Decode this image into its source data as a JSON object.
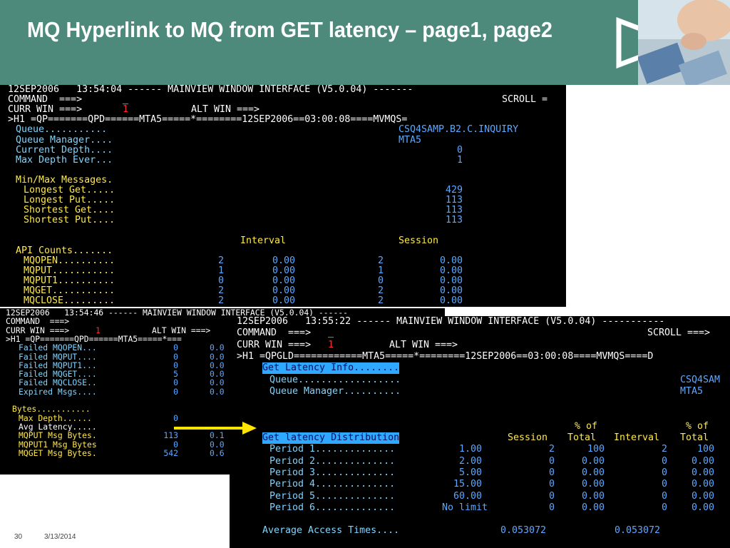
{
  "slide": {
    "title": "MQ Hyperlink to MQ from GET latency – page1, page2",
    "page_number": "30",
    "date": "3/13/2014"
  },
  "window1": {
    "header": "12SEP2006   13:54:04 ------ MAINVIEW WINDOW INTERFACE (V5.0.04) -------",
    "command_label": "COMMAND  ===>",
    "command_value": "_",
    "scroll_label": "SCROLL =",
    "currwin_label": "CURR WIN ===>",
    "currwin_value": "1",
    "altwin_label": "ALT WIN ===>",
    "status_line": ">H1 =QP=======QPD======MTA5=====*========12SEP2006==03:00:08====MVMQS=",
    "queue_label": "Queue...........",
    "queue_value": "CSQ4SAMP.B2.C.INQUIRY",
    "qmgr_label": "Queue Manager....",
    "qmgr_value": "MTA5",
    "curdepth_label": "Current Depth....",
    "curdepth_value": "0",
    "maxdepth_label": "Max Depth Ever...",
    "maxdepth_value": "1",
    "minmax_label": "Min/Max Messages.",
    "longget_label": "Longest Get.....",
    "longget_value": "429",
    "longput_label": "Longest Put.....",
    "longput_value": "113",
    "shortget_label": "Shortest Get....",
    "shortget_value": "113",
    "shortput_label": "Shortest Put....",
    "shortput_value": "113",
    "interval_header": "Interval",
    "session_header": "Session",
    "api_label": "API Counts.......",
    "api_rows": [
      {
        "label": "MQOPEN..........",
        "c1": "2",
        "v1": "0.00",
        "c2": "2",
        "v2": "0.00"
      },
      {
        "label": "MQPUT...........",
        "c1": "1",
        "v1": "0.00",
        "c2": "1",
        "v2": "0.00"
      },
      {
        "label": "MQPUT1..........",
        "c1": "0",
        "v1": "0.00",
        "c2": "0",
        "v2": "0.00"
      },
      {
        "label": "MQGET...........",
        "c1": "2",
        "v1": "0.00",
        "c2": "2",
        "v2": "0.00"
      },
      {
        "label": "MQCLOSE.........",
        "c1": "2",
        "v1": "0.00",
        "c2": "2",
        "v2": "0.00"
      }
    ]
  },
  "window2": {
    "header": "12SEP2006   13:54:46 ------ MAINVIEW WINDOW INTERFACE (V5.0.04) ------",
    "command_label": "COMMAND  ===>",
    "currwin_label": "CURR WIN ===>",
    "currwin_value": "1",
    "altwin_label": "ALT WIN ===>",
    "status_line": ">H1 =QP=======QPD======MTA5=====*===",
    "rows": [
      {
        "label": "Failed MQOPEN...",
        "c": "0",
        "v": "0.0"
      },
      {
        "label": "Failed MQPUT....",
        "c": "0",
        "v": "0.0"
      },
      {
        "label": "Failed MQPUT1...",
        "c": "0",
        "v": "0.0"
      },
      {
        "label": "Failed MQGET....",
        "c": "5",
        "v": "0.0"
      },
      {
        "label": "Failed MQCLOSE..",
        "c": "0",
        "v": "0.0"
      },
      {
        "label": "Expired Msgs....",
        "c": "0",
        "v": "0.0"
      }
    ],
    "bytes_label": "Bytes...........",
    "maxdepth_label": "Max Depth......",
    "maxdepth_value": "0",
    "avglat_label": "Avg Latency.....",
    "putbytes_label": "MQPUT Msg Bytes.",
    "putbytes_value": "113",
    "putbytes_v": "0.1",
    "put1bytes_label": "MQPUT1 Msg Bytes",
    "put1bytes_value": "0",
    "put1bytes_v": "0.0",
    "getbytes_label": "MQGET Msg Bytes.",
    "getbytes_value": "542",
    "getbytes_v": "0.6"
  },
  "window3": {
    "header": "12SEP2006   13:55:22 ------ MAINVIEW WINDOW INTERFACE (V5.0.04) -----------",
    "command_label": "COMMAND  ===>",
    "command_value": "_",
    "scroll_label": "SCROLL ===>",
    "currwin_label": "CURR WIN ===>",
    "currwin_value": "1",
    "altwin_label": "ALT WIN ===>",
    "status_line": ">H1 =QPGLD============MTA5=====*========12SEP2006==03:00:08====MVMQS====D",
    "section_label": "Get Latency Info........",
    "queue_label": "Queue..................",
    "queue_value": "CSQ4SAM",
    "qmgr_label": "Queue Manager..........",
    "qmgr_value": "MTA5",
    "pct_of": "% of",
    "dist_label": "Get latency Distribution",
    "session_header": "Session",
    "total_header": "Total",
    "interval_header": "Interval",
    "period_rows": [
      {
        "label": "Period 1..............",
        "limit": "1.00",
        "session": "2",
        "session_pct": "100",
        "interval": "2",
        "interval_pct": "100"
      },
      {
        "label": "Period 2..............",
        "limit": "2.00",
        "session": "0",
        "session_pct": "0.00",
        "interval": "0",
        "interval_pct": "0.00"
      },
      {
        "label": "Period 3..............",
        "limit": "5.00",
        "session": "0",
        "session_pct": "0.00",
        "interval": "0",
        "interval_pct": "0.00"
      },
      {
        "label": "Period 4..............",
        "limit": "15.00",
        "session": "0",
        "session_pct": "0.00",
        "interval": "0",
        "interval_pct": "0.00"
      },
      {
        "label": "Period 5..............",
        "limit": "60.00",
        "session": "0",
        "session_pct": "0.00",
        "interval": "0",
        "interval_pct": "0.00"
      },
      {
        "label": "Period 6..............",
        "limit": "No limit",
        "session": "0",
        "session_pct": "0.00",
        "interval": "0",
        "interval_pct": "0.00"
      }
    ],
    "avg_label": "Average Access Times....",
    "avg_session": "0.053072",
    "avg_interval": "0.053072"
  },
  "colors": {
    "title_bar": "#4d8a7c",
    "terminal_bg": "#000000",
    "turquoise": "#7fd4ff",
    "yellow": "#ffe84a",
    "highlight": "#2fa9ff",
    "arrow": "#ffe600"
  },
  "icons": {
    "play": "play-triangle-icon",
    "arrow": "right-arrow-icon"
  }
}
